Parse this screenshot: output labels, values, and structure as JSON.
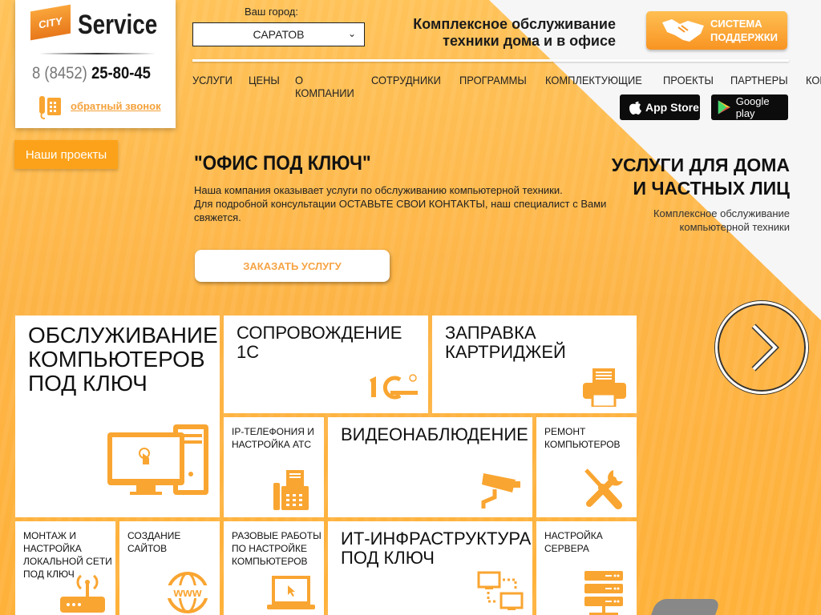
{
  "logo": {
    "badge": "CITY",
    "name": "Service"
  },
  "contact": {
    "phone_prefix": "8 (8452)",
    "phone_number": "25-80-45",
    "callback_label": "обратный звонок"
  },
  "projects_button": "Наши проекты",
  "city": {
    "label": "Ваш город:",
    "selected": "САРАТОВ"
  },
  "tagline": {
    "line1": "Комплексное обслуживание",
    "line2": "техники дома и в офисе"
  },
  "support_button": {
    "line1": "СИСТЕМА",
    "line2": "ПОДДЕРЖКИ"
  },
  "nav": [
    "УСЛУГИ",
    "ЦЕНЫ",
    "О КОМПАНИИ",
    "СОТРУДНИКИ",
    "ПРОГРАММЫ",
    "КОМПЛЕКТУЮЩИЕ",
    "ПРОЕКТЫ",
    "ПАРТНЕРЫ",
    "КОНТАКТЫ"
  ],
  "stores": {
    "appstore": "App Store",
    "googleplay": "Google play"
  },
  "hero": {
    "title": "\"ОФИС ПОД КЛЮЧ\"",
    "line1": "Наша компания оказывает услуги по обслуживанию компьютерной техники.",
    "line2": "Для подробной консультации ОСТАВЬТЕ СВОИ КОНТАКТЫ, наш специалист с Вами свяжется.",
    "button": "ЗАКАЗАТЬ УСЛУГУ"
  },
  "home": {
    "title1": "УСЛУГИ ДЛЯ ДОМА",
    "title2": "И ЧАСТНЫХ ЛИЦ",
    "sub1": "Комплексное обслуживание",
    "sub2": "компьютерной техники"
  },
  "tiles": {
    "computers": "ОБСЛУЖИВАНИЕ КОМПЬЮТЕРОВ ПОД КЛЮЧ",
    "support1c": "СОПРОВОЖДЕНИЕ 1С",
    "cartridges": "ЗАПРАВКА КАРТРИДЖЕЙ",
    "iptel": "IP-ТЕЛЕФОНИЯ И НАСТРОЙКА АТС",
    "video": "ВИДЕОНАБЛЮДЕНИЕ",
    "repair": "РЕМОНТ КОМПЬЮТЕРОВ",
    "lan": "МОНТАЖ И НАСТРОЙКА ЛОКАЛЬНОЙ СЕТИ ПОД КЛЮЧ",
    "sites": "СОЗДАНИЕ САЙТОВ",
    "oneoff": "РАЗОВЫЕ РАБОТЫ ПО НАСТРОЙКЕ КОМПЬЮТЕРОВ",
    "infra": "ИТ-ИНФРАСТРУКТУРА ПОД КЛЮЧ",
    "server": "НАСТРОЙКА СЕРВЕРА"
  },
  "colors": {
    "accent": "#fca21a",
    "icon": "#f9a531",
    "link": "#f4a13a"
  }
}
